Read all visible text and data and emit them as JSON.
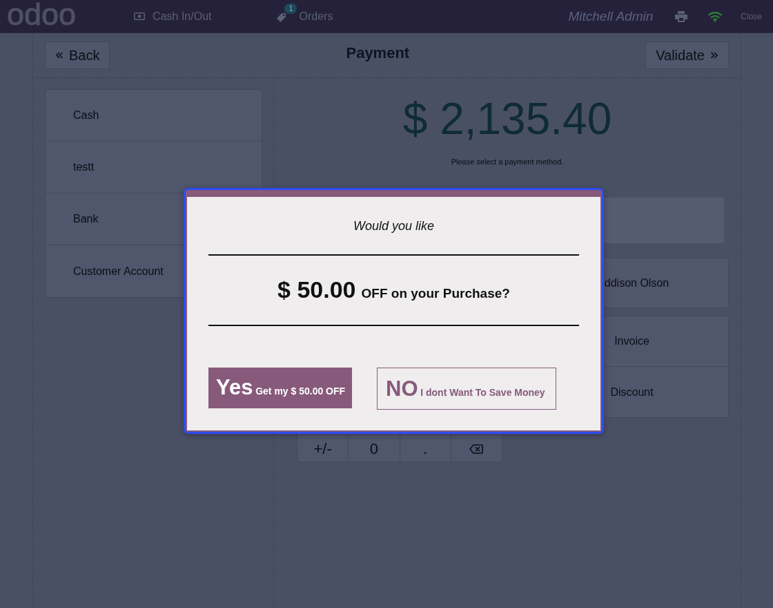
{
  "topbar": {
    "logo": "odoo",
    "nav": [
      {
        "kind": "cash",
        "label": "Cash In/Out"
      },
      {
        "kind": "orders",
        "label": "Orders",
        "badge": "1"
      }
    ],
    "user": "Mitchell Admin",
    "close": "Close"
  },
  "header": {
    "back": "Back",
    "title": "Payment",
    "validate": "Validate"
  },
  "payment_methods": [
    {
      "label": "Cash"
    },
    {
      "label": "testt"
    },
    {
      "label": "Bank"
    },
    {
      "label": "Customer Account"
    }
  ],
  "summary": {
    "amount": "$ 2,135.40",
    "status": "Please select a payment method."
  },
  "customer": "ddison Olson",
  "options": [
    {
      "label": "Invoice"
    },
    {
      "label": "Discount"
    }
  ],
  "numpad": [
    {
      "kind": "text",
      "label": "+/-"
    },
    {
      "kind": "text",
      "label": "0"
    },
    {
      "kind": "text",
      "label": "."
    },
    {
      "kind": "backspace"
    }
  ],
  "dialog": {
    "intro": "Would you like",
    "amount": "$ 50.00",
    "offer": "OFF on your Purchase?",
    "accept": {
      "title": "Yes",
      "detail": "Get my $ 50.00 OFF"
    },
    "decline": {
      "title": "NO",
      "detail": "I dont Want To Save Money"
    }
  }
}
